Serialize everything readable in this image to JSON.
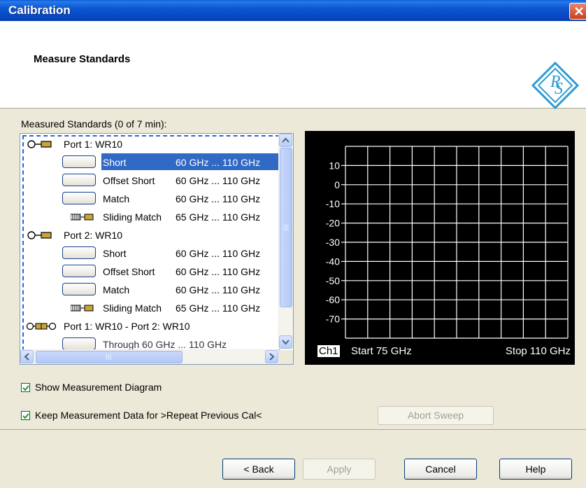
{
  "window": {
    "title": "Calibration"
  },
  "header": {
    "title": "Measure Standards",
    "logo_text": "R&S"
  },
  "standards": {
    "label": "Measured Standards (0 of 7 min):",
    "port1": "Port 1: WR10",
    "port2": "Port 2: WR10",
    "port12": "Port 1: WR10 - Port 2: WR10",
    "items": [
      {
        "name": "Short",
        "range": "60 GHz ... 110 GHz"
      },
      {
        "name": "Offset Short",
        "range": "60 GHz ... 110 GHz"
      },
      {
        "name": "Match",
        "range": "60 GHz ... 110 GHz"
      },
      {
        "name": "Sliding Match",
        "range": "65 GHz ... 110 GHz"
      },
      {
        "name": "Short",
        "range": "60 GHz ... 110 GHz"
      },
      {
        "name": "Offset Short",
        "range": "60 GHz ... 110 GHz"
      },
      {
        "name": "Match",
        "range": "60 GHz ... 110 GHz"
      },
      {
        "name": "Sliding Match",
        "range": "65 GHz ... 110 GHz"
      }
    ],
    "partial_row": "Through   60 GHz ... 110 GHz"
  },
  "diagram": {
    "channel": "Ch1",
    "start": "Start 75 GHz",
    "stop": "Stop 110 GHz",
    "y_ticks": [
      "10",
      "0",
      "-10",
      "-20",
      "-30",
      "-40",
      "-50",
      "-60",
      "-70"
    ]
  },
  "options": {
    "show_diagram_label": "Show Measurement Diagram",
    "show_diagram_checked": true,
    "keep_data_label": "Keep Measurement Data for >Repeat Previous Cal<",
    "keep_data_checked": true
  },
  "buttons": {
    "abort": "Abort Sweep",
    "back": "< Back",
    "apply": "Apply",
    "cancel": "Cancel",
    "help": "Help"
  },
  "colors": {
    "selection": "#316AC5",
    "titlebar": "#0A5FD9",
    "logo": "#2B9BD3"
  }
}
